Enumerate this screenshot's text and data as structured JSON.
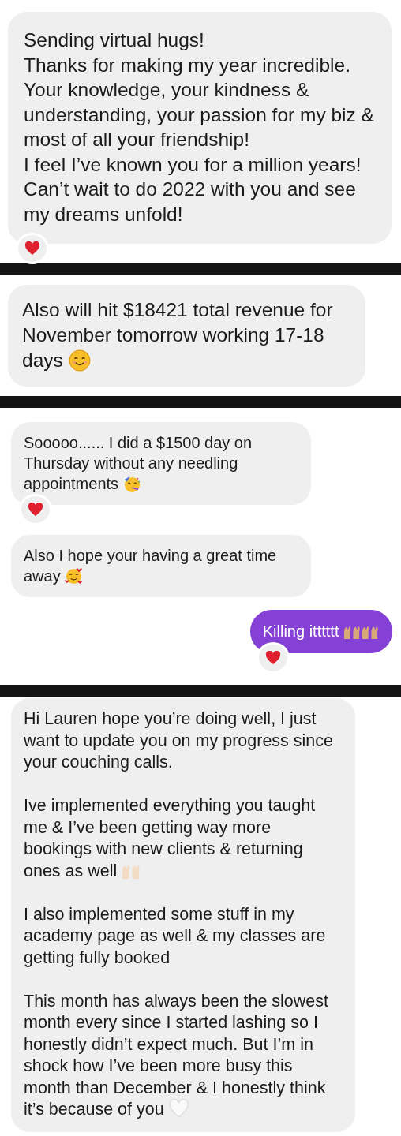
{
  "panels": [
    {
      "messages": [
        {
          "kind": "received",
          "reacted": true,
          "paragraphs": [
            {
              "text": "Sending virtual hugs!\nThanks for making my year incredible.\nYour knowledge, your kindness & understanding, your passion for my biz & most of all your friendship!\nI feel I’ve known you for a million years!\nCan’t wait to do 2022 with you and see my dreams unfold!"
            }
          ]
        }
      ]
    },
    {
      "messages": [
        {
          "kind": "received",
          "reacted": false,
          "paragraphs": [
            {
              "text": "Also will hit $18421 total revenue for November tomorrow working 17-18 days",
              "emoji": [
                {
                  "kind": "smile"
                }
              ]
            }
          ]
        }
      ]
    },
    {
      "messages": [
        {
          "kind": "received",
          "reacted": true,
          "paragraphs": [
            {
              "text": "Sooooo...... I did a $1500 day on Thursday without any needling appointments",
              "emoji": [
                {
                  "kind": "party"
                }
              ]
            }
          ]
        },
        {
          "kind": "received",
          "reacted": false,
          "paragraphs": [
            {
              "text": "Also I hope your having a great time away",
              "emoji": [
                {
                  "kind": "hearts-face"
                }
              ]
            }
          ]
        },
        {
          "kind": "sent",
          "reacted": true,
          "paragraphs": [
            {
              "text": "Killing itttttt",
              "emoji": [
                {
                  "kind": "raised-hands"
                },
                {
                  "kind": "raised-hands"
                }
              ]
            }
          ]
        }
      ]
    },
    {
      "messages": [
        {
          "kind": "received",
          "reacted": false,
          "paragraphs": [
            {
              "text": "Hi Lauren hope you’re doing well, I just want to update you on my progress since your couching calls."
            },
            {
              "text": "Ive implemented everything you taught me & I’ve been getting way more bookings with new clients & returning ones as well",
              "emoji": [
                {
                  "kind": "raised-hands-light"
                }
              ]
            },
            {
              "text": "I also implemented some stuff in my academy page as well & my classes are getting fully booked"
            },
            {
              "text": "This month has always been the slowest month every since I started lashing so I honestly didn’t expect much. But I’m in shock how I’ve been more busy this month than December & I honestly think it’s because of you",
              "emoji": [
                {
                  "kind": "white-heart"
                }
              ]
            }
          ]
        }
      ]
    }
  ]
}
